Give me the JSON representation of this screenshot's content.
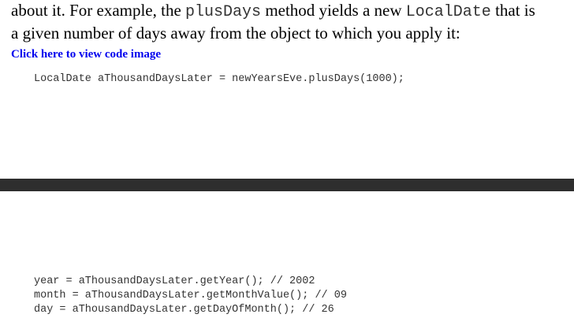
{
  "page1": {
    "paragraph": {
      "seg1": "about it. For example, the ",
      "code1": "plusDays",
      "seg2": " method yields a new ",
      "code2": "LocalDate",
      "seg3": " that is",
      "line2": "a given number of days away from the object to which you apply it:"
    },
    "link_label": "Click here to view code image",
    "code_line": "LocalDate aThousandDaysLater = newYearsEve.plusDays(1000);"
  },
  "page2": {
    "code_lines": [
      "year = aThousandDaysLater.getYear(); // 2002",
      "month = aThousandDaysLater.getMonthValue(); // 09",
      "day = aThousandDaysLater.getDayOfMonth(); // 26"
    ]
  },
  "colors": {
    "link": "#0000ee",
    "divider": "#2e2e2e",
    "code_text": "#333333"
  }
}
